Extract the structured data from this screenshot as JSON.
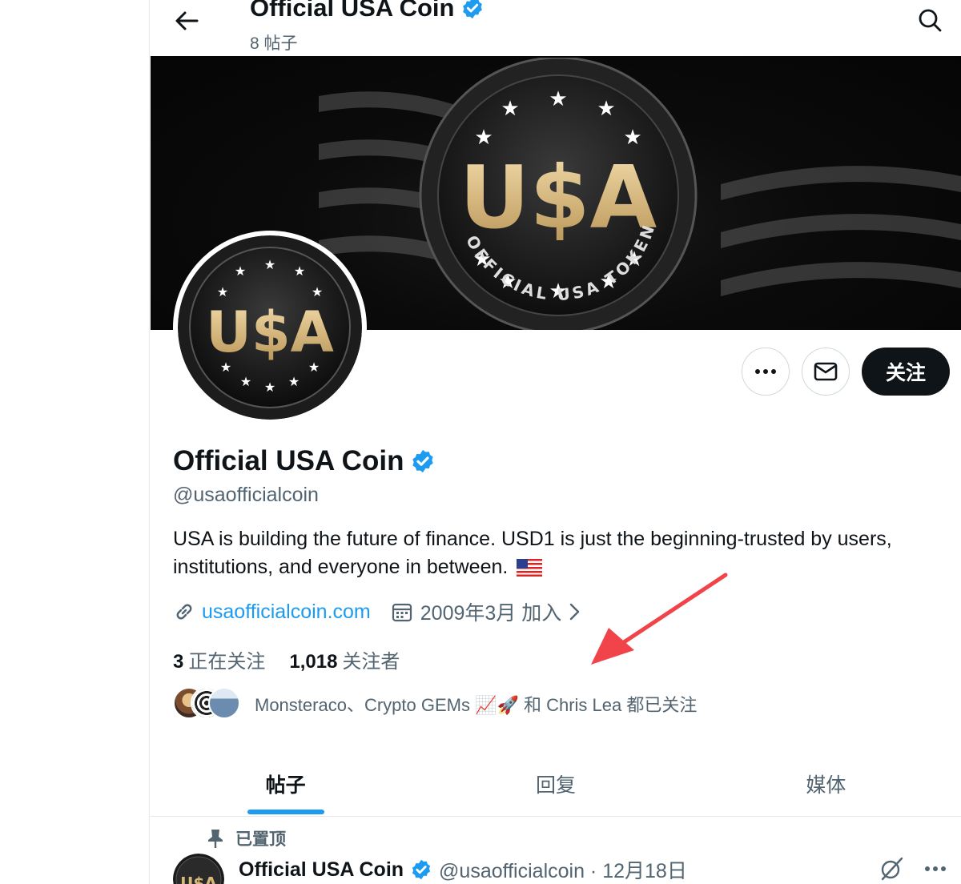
{
  "header": {
    "title": "Official USA Coin",
    "post_count": "8 帖子"
  },
  "banner": {
    "coin_text": "U$A",
    "ring_text": "OFFICIAL USA TOKEN"
  },
  "actions": {
    "follow_label": "关注"
  },
  "profile": {
    "name": "Official USA Coin",
    "handle": "@usaofficialcoin",
    "bio": "USA is building the future of finance. USD1 is just the beginning-trusted by users, institutions, and everyone in between.",
    "website": "usaofficialcoin.com",
    "joined": "2009年3月 加入",
    "following_count": "3",
    "following_label": "正在关注",
    "followers_count": "1,018",
    "followers_label": "关注者",
    "followed_by": "Monsteraco、Crypto GEMs 📈🚀 和 Chris Lea 都已关注"
  },
  "tabs": [
    {
      "label": "帖子",
      "active": true
    },
    {
      "label": "回复",
      "active": false
    },
    {
      "label": "媒体",
      "active": false
    }
  ],
  "pinned_post": {
    "pinned_label": "已置顶",
    "author": "Official USA Coin",
    "handle_date": "@usaofficialcoin · 12月18日"
  },
  "colors": {
    "accent": "#1d9bf0",
    "text": "#0f1419",
    "secondary": "#536471",
    "gold": "#d8b878",
    "annotation": "#f0444a"
  },
  "icons": [
    "back-arrow-icon",
    "search-icon",
    "verified-badge-icon",
    "more-icon",
    "mail-icon",
    "link-icon",
    "calendar-icon",
    "chevron-right-icon",
    "pin-icon",
    "grok-icon"
  ]
}
